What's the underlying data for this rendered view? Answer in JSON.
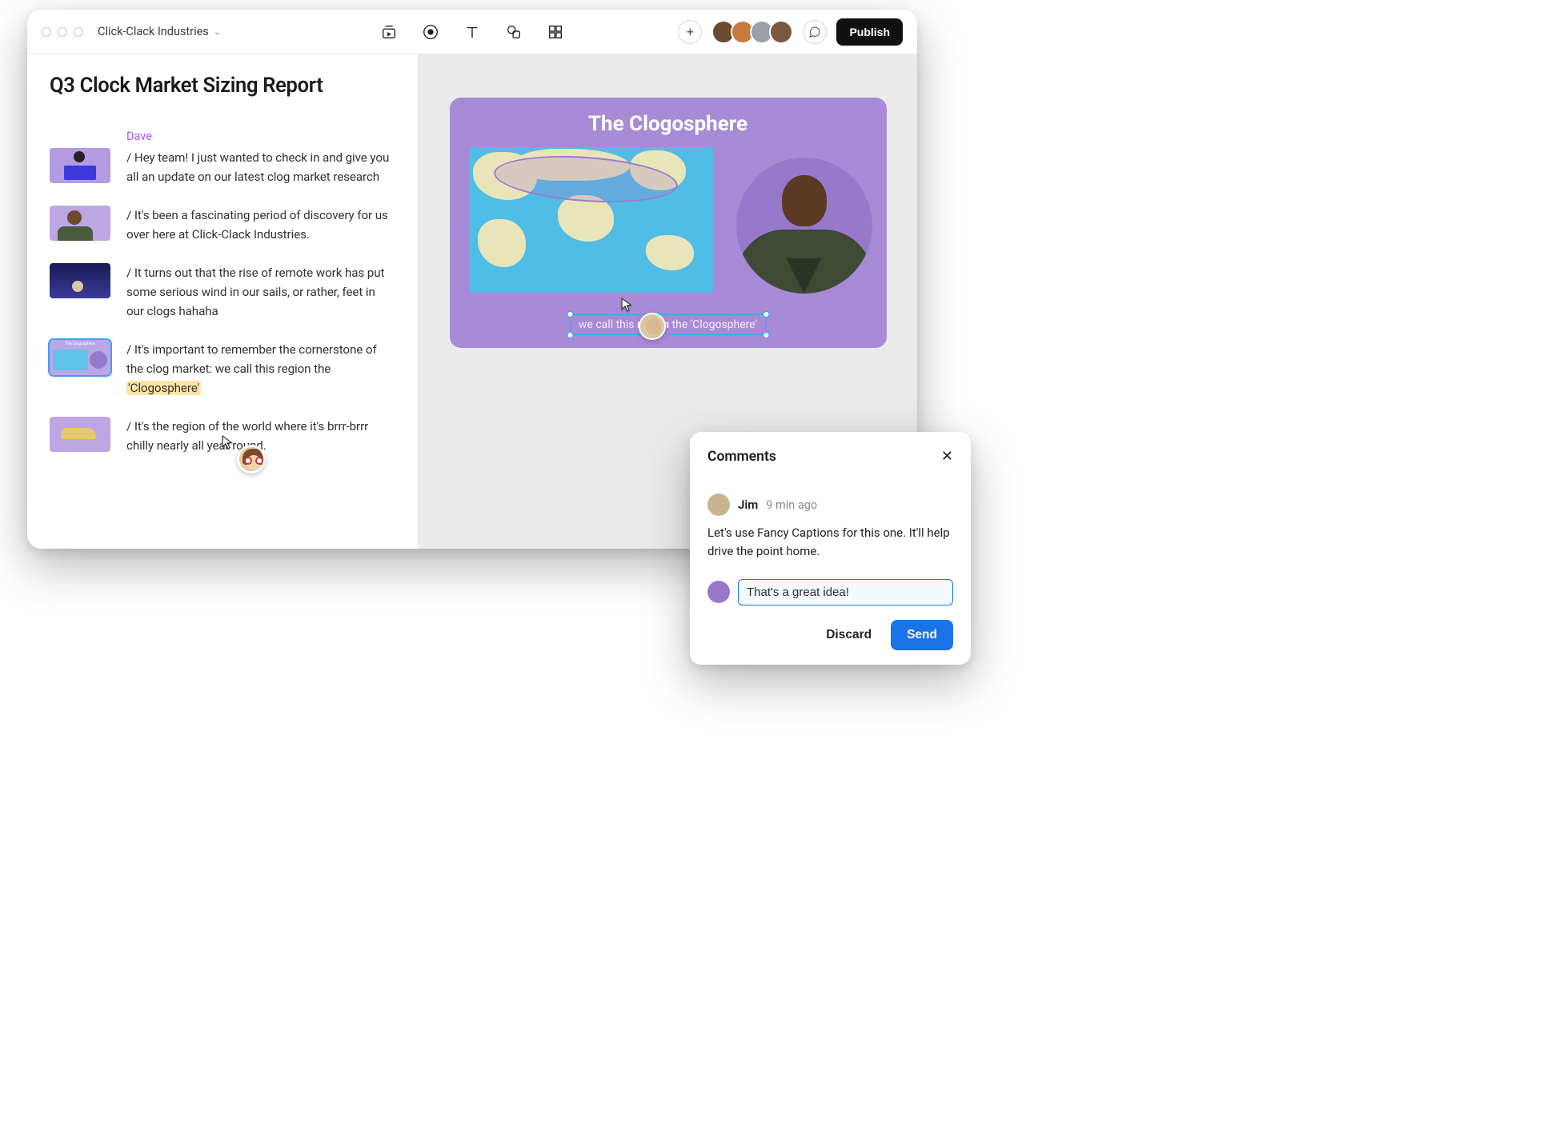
{
  "header": {
    "workspace": "Click-Clack Industries",
    "publish_label": "Publish"
  },
  "document": {
    "title": "Q3 Clock Market Sizing Report",
    "author": "Dave",
    "lines": [
      "/ Hey team! I just wanted to check in and give you all an update on our latest clog market research",
      "/ It's been a fascinating period of discovery for us over here at Click-Clack Industries.",
      "/ It turns out that the rise of remote work has put some serious wind in our sails, or rather, feet in our clogs hahaha",
      "/ It's important to remember the cornerstone of the clog market: we call this region the ",
      "/ It's the region of the world where it's brrr-brrr chilly nearly all year round."
    ],
    "highlight": "'Clogosphere'",
    "thumb_map_title": "The Clogosphere"
  },
  "slide": {
    "title": "The Clogosphere",
    "caption_prefix": "we call this ",
    "caption_bold": "region",
    "caption_suffix": " the 'Clogosphere'"
  },
  "comments": {
    "title": "Comments",
    "items": [
      {
        "author": "Jim",
        "time": "9 min ago",
        "body": "Let's use Fancy Captions for this one. It'll help drive the point home."
      }
    ],
    "reply_value": "That's a great idea!",
    "discard_label": "Discard",
    "send_label": "Send"
  },
  "colors": {
    "accent_purple": "#a78bd6",
    "selection_blue": "#3ca0f6",
    "primary_blue": "#1a73e8",
    "highlight_yellow": "#ffe3a8",
    "author_purple": "#a855f7"
  }
}
